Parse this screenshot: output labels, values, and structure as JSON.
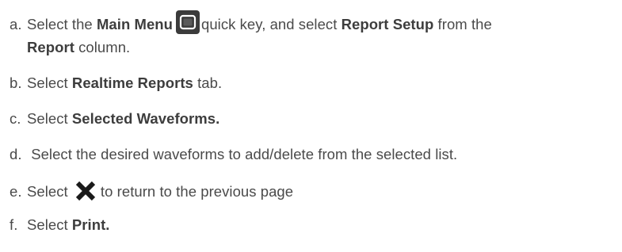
{
  "steps": [
    {
      "letter": "a.",
      "line1_pre": "Select the ",
      "line1_bold1": "Main Menu",
      "line1_mid": "quick key, and select ",
      "line1_bold2": "Report Setup",
      "line1_post": " from the",
      "line2_bold": "Report",
      "line2_post": " column.",
      "icon": "main-menu-key-icon"
    },
    {
      "letter": "b.",
      "pre": "Select ",
      "bold": "Realtime Reports",
      "post": " tab."
    },
    {
      "letter": "c.",
      "pre": "Select ",
      "bold": "Selected Waveforms.",
      "post": ""
    },
    {
      "letter": "d.",
      "pre": " Select the desired waveforms to add/delete from the selected list.",
      "bold": "",
      "post": ""
    },
    {
      "letter": "e.",
      "pre": "Select ",
      "post": "to return to the previous page",
      "icon": "close-x-icon"
    },
    {
      "letter": "f.",
      "pre": "Select ",
      "bold": "Print.",
      "post": ""
    }
  ]
}
